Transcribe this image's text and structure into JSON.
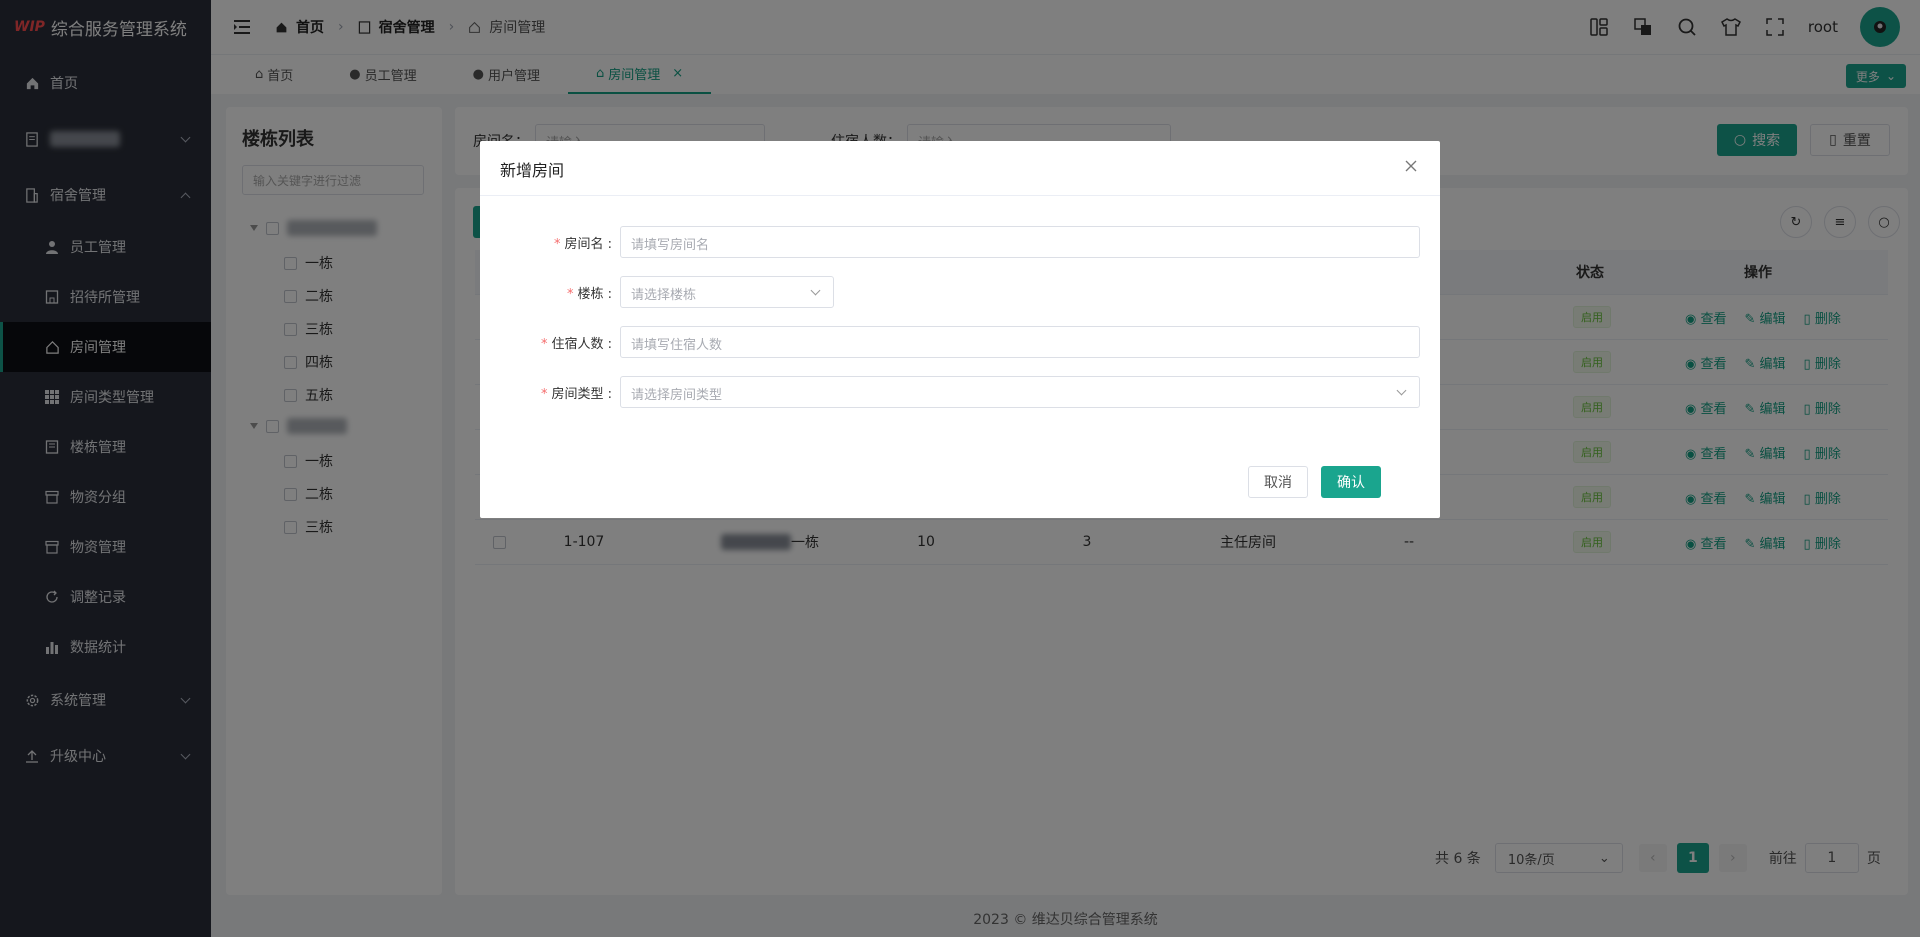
{
  "brand": {
    "logo": "WIP",
    "title": "综合服务管理系统"
  },
  "sidebar": {
    "items": [
      {
        "label": "首页",
        "icon": "home-icon"
      },
      {
        "label": "",
        "icon": "document-icon"
      },
      {
        "label": "宿舍管理",
        "icon": "building-icon"
      },
      {
        "label": "员工管理",
        "icon": "user-icon"
      },
      {
        "label": "招待所管理",
        "icon": "building-icon"
      },
      {
        "label": "房间管理",
        "icon": "house-icon"
      },
      {
        "label": "房间类型管理",
        "icon": "grid-icon"
      },
      {
        "label": "楼栋管理",
        "icon": "building-icon"
      },
      {
        "label": "物资分组",
        "icon": "box-icon"
      },
      {
        "label": "物资管理",
        "icon": "box-icon"
      },
      {
        "label": "调整记录",
        "icon": "refresh-icon"
      },
      {
        "label": "数据统计",
        "icon": "bar-chart-icon"
      },
      {
        "label": "系统管理",
        "icon": "gear-icon"
      },
      {
        "label": "升级中心",
        "icon": "upload-icon"
      }
    ]
  },
  "header": {
    "breadcrumb": [
      "首页",
      "宿舍管理",
      "房间管理"
    ],
    "username": "root"
  },
  "tabs": [
    {
      "label": "首页"
    },
    {
      "label": "员工管理"
    },
    {
      "label": "用户管理"
    },
    {
      "label": "房间管理",
      "close": "×"
    }
  ],
  "more_label": "更多",
  "building_panel": {
    "title": "楼栋列表",
    "filter_placeholder": "输入关键字进行过滤",
    "group1_children": [
      "一栋",
      "二栋",
      "三栋",
      "四栋",
      "五栋"
    ],
    "group2_children": [
      "一栋",
      "二栋",
      "三栋"
    ]
  },
  "search": {
    "room_name_label": "房间名：",
    "room_placeholder": "请输入",
    "occupancy_label": "住宿人数：",
    "occupancy_placeholder": "请输入",
    "search_label": "搜索",
    "reset_label": "重置"
  },
  "table": {
    "headers": {
      "status": "状态",
      "actions": "操作"
    },
    "status_text": "启用",
    "actions": {
      "view": "查看",
      "edit": "编辑",
      "delete": "删除"
    },
    "last_row": {
      "room": "1-107",
      "building_suffix": "一栋",
      "capacity": "10",
      "occupied": "3",
      "type": "主任房间",
      "remark": "--"
    }
  },
  "pagination": {
    "total": "共 6 条",
    "page_size": "10条/页",
    "current_page": "1",
    "goto_label": "前往",
    "goto_value": "1",
    "page_suffix": "页"
  },
  "footer": "2023 © 维达贝综合管理系统",
  "modal": {
    "title": "新增房间",
    "fields": {
      "room_name": {
        "label": "房间名 :",
        "placeholder": "请填写房间名"
      },
      "building": {
        "label": "楼栋 :",
        "placeholder": "请选择楼栋"
      },
      "occupancy": {
        "label": "住宿人数 :",
        "placeholder": "请填写住宿人数"
      },
      "room_type": {
        "label": "房间类型 :",
        "placeholder": "请选择房间类型"
      }
    },
    "cancel_label": "取消",
    "confirm_label": "确认"
  },
  "colors": {
    "primary": "#1aa58e",
    "sidebar_bg": "#2b2f3a",
    "status_green": "#67c23a",
    "required": "#f56c6c"
  }
}
